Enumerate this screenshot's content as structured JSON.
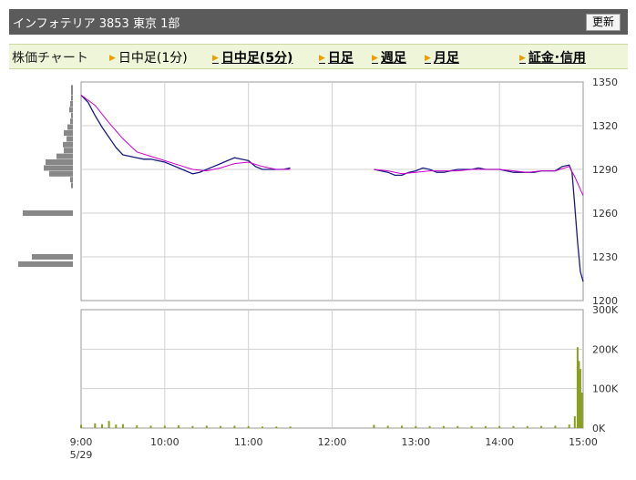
{
  "header": {
    "title": "インフォテリア  3853  東京 1部",
    "update_label": "更新"
  },
  "tabs": {
    "title": "株価チャート",
    "items": [
      {
        "label": "日中足(1分)",
        "bold": false
      },
      {
        "label": "日中足(5分)",
        "bold": true
      },
      {
        "label": "日足",
        "bold": true
      },
      {
        "label": "週足",
        "bold": true
      },
      {
        "label": "月足",
        "bold": true
      },
      {
        "label": "証金･信用",
        "bold": true
      }
    ]
  },
  "chart_data": {
    "type": "line",
    "date_label": "5/29",
    "x_ticks": [
      "9:00",
      "10:00",
      "11:00",
      "12:00",
      "13:00",
      "14:00",
      "15:00"
    ],
    "price": {
      "y_ticks": [
        1350,
        1320,
        1290,
        1260,
        1230,
        1200
      ],
      "ylim": [
        1200,
        1350
      ],
      "series": [
        {
          "color": "#1a1a80",
          "points": [
            [
              "9:00",
              1341
            ],
            [
              "9:05",
              1336
            ],
            [
              "9:10",
              1327
            ],
            [
              "9:15",
              1319
            ],
            [
              "9:20",
              1312
            ],
            [
              "9:25",
              1305
            ],
            [
              "9:30",
              1300
            ],
            [
              "9:35",
              1299
            ],
            [
              "9:40",
              1298
            ],
            [
              "9:45",
              1297
            ],
            [
              "9:50",
              1297
            ],
            [
              "9:55",
              1296
            ],
            [
              "10:00",
              1295
            ],
            [
              "10:05",
              1293
            ],
            [
              "10:10",
              1291
            ],
            [
              "10:15",
              1289
            ],
            [
              "10:20",
              1287
            ],
            [
              "10:25",
              1288
            ],
            [
              "10:30",
              1290
            ],
            [
              "10:35",
              1292
            ],
            [
              "10:40",
              1294
            ],
            [
              "10:45",
              1296
            ],
            [
              "10:50",
              1298
            ],
            [
              "10:55",
              1297
            ],
            [
              "11:00",
              1296
            ],
            [
              "11:05",
              1292
            ],
            [
              "11:10",
              1290
            ],
            [
              "11:15",
              1290
            ],
            [
              "11:20",
              1290
            ],
            [
              "11:25",
              1290
            ],
            [
              "11:30",
              1291
            ],
            [
              "12:30",
              1290
            ],
            [
              "12:35",
              1289
            ],
            [
              "12:40",
              1288
            ],
            [
              "12:45",
              1286
            ],
            [
              "12:50",
              1286
            ],
            [
              "12:55",
              1288
            ],
            [
              "13:00",
              1289
            ],
            [
              "13:05",
              1291
            ],
            [
              "13:10",
              1290
            ],
            [
              "13:15",
              1288
            ],
            [
              "13:20",
              1288
            ],
            [
              "13:25",
              1289
            ],
            [
              "13:30",
              1290
            ],
            [
              "13:35",
              1290
            ],
            [
              "13:40",
              1290
            ],
            [
              "13:45",
              1291
            ],
            [
              "13:50",
              1290
            ],
            [
              "13:55",
              1290
            ],
            [
              "14:00",
              1290
            ],
            [
              "14:05",
              1289
            ],
            [
              "14:10",
              1288
            ],
            [
              "14:15",
              1288
            ],
            [
              "14:20",
              1288
            ],
            [
              "14:25",
              1288
            ],
            [
              "14:30",
              1289
            ],
            [
              "14:35",
              1289
            ],
            [
              "14:40",
              1289
            ],
            [
              "14:45",
              1292
            ],
            [
              "14:50",
              1293
            ],
            [
              "14:52",
              1288
            ],
            [
              "14:54",
              1265
            ],
            [
              "14:56",
              1240
            ],
            [
              "14:58",
              1220
            ],
            [
              "15:00",
              1213
            ]
          ]
        },
        {
          "color": "#cc00cc",
          "points": [
            [
              "9:00",
              1341
            ],
            [
              "9:10",
              1334
            ],
            [
              "9:20",
              1322
            ],
            [
              "9:30",
              1311
            ],
            [
              "9:40",
              1302
            ],
            [
              "9:50",
              1299
            ],
            [
              "10:00",
              1296
            ],
            [
              "10:10",
              1293
            ],
            [
              "10:20",
              1290
            ],
            [
              "10:30",
              1289
            ],
            [
              "10:40",
              1291
            ],
            [
              "10:50",
              1294
            ],
            [
              "11:00",
              1295
            ],
            [
              "11:10",
              1292
            ],
            [
              "11:20",
              1290
            ],
            [
              "11:30",
              1290
            ],
            [
              "12:30",
              1290
            ],
            [
              "12:40",
              1289
            ],
            [
              "12:50",
              1287
            ],
            [
              "13:00",
              1288
            ],
            [
              "13:10",
              1289
            ],
            [
              "13:20",
              1289
            ],
            [
              "13:30",
              1289
            ],
            [
              "13:40",
              1290
            ],
            [
              "13:50",
              1290
            ],
            [
              "14:00",
              1290
            ],
            [
              "14:10",
              1289
            ],
            [
              "14:20",
              1288
            ],
            [
              "14:30",
              1289
            ],
            [
              "14:40",
              1289
            ],
            [
              "14:50",
              1292
            ],
            [
              "14:54",
              1285
            ],
            [
              "15:00",
              1272
            ]
          ]
        }
      ]
    },
    "volume": {
      "y_ticks": [
        "300K",
        "200K",
        "100K",
        "0K"
      ],
      "ylim": [
        0,
        300000
      ],
      "color": "#8aa020",
      "bars": [
        [
          "9:00",
          8000
        ],
        [
          "9:10",
          12000
        ],
        [
          "9:15",
          10000
        ],
        [
          "9:20",
          18000
        ],
        [
          "9:25",
          9000
        ],
        [
          "9:30",
          10000
        ],
        [
          "9:40",
          7000
        ],
        [
          "9:50",
          6000
        ],
        [
          "10:00",
          6000
        ],
        [
          "10:10",
          7000
        ],
        [
          "10:20",
          5000
        ],
        [
          "10:30",
          6000
        ],
        [
          "10:40",
          5000
        ],
        [
          "10:50",
          6000
        ],
        [
          "11:00",
          5000
        ],
        [
          "11:10",
          4000
        ],
        [
          "11:20",
          4000
        ],
        [
          "11:30",
          4000
        ],
        [
          "12:30",
          8000
        ],
        [
          "12:40",
          6000
        ],
        [
          "12:50",
          6000
        ],
        [
          "13:00",
          5000
        ],
        [
          "13:10",
          5000
        ],
        [
          "13:20",
          5000
        ],
        [
          "13:30",
          5000
        ],
        [
          "13:40",
          5000
        ],
        [
          "13:50",
          5000
        ],
        [
          "14:00",
          5000
        ],
        [
          "14:10",
          5000
        ],
        [
          "14:20",
          5000
        ],
        [
          "14:30",
          5000
        ],
        [
          "14:40",
          6000
        ],
        [
          "14:50",
          9000
        ],
        [
          "14:54",
          30000
        ],
        [
          "14:56",
          205000
        ],
        [
          "14:57",
          170000
        ],
        [
          "14:58",
          150000
        ],
        [
          "14:59",
          90000
        ]
      ]
    },
    "price_volume_profile": {
      "color": "#888888",
      "rows": [
        [
          1346,
          2
        ],
        [
          1343,
          2
        ],
        [
          1339,
          2
        ],
        [
          1335,
          3
        ],
        [
          1331,
          4
        ],
        [
          1327,
          2
        ],
        [
          1323,
          3
        ],
        [
          1319,
          6
        ],
        [
          1315,
          10
        ],
        [
          1311,
          7
        ],
        [
          1307,
          11
        ],
        [
          1303,
          10
        ],
        [
          1299,
          18
        ],
        [
          1295,
          30
        ],
        [
          1291,
          32
        ],
        [
          1287,
          26
        ],
        [
          1283,
          3
        ],
        [
          1279,
          2
        ],
        [
          1260,
          55
        ],
        [
          1230,
          45
        ],
        [
          1225,
          60
        ]
      ]
    }
  }
}
